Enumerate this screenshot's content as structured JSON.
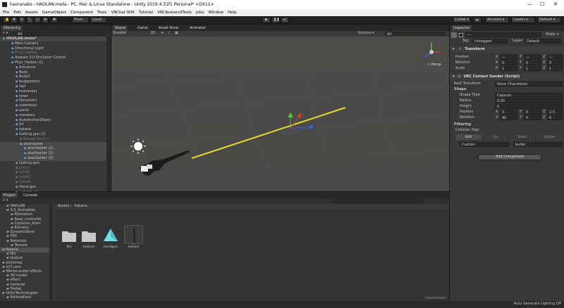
{
  "window": {
    "title": "haoranabs - HAOLAN.meta - PC, Mac & Linux Standalone - Unity 2019.4.31f1 Personal* <DX11>",
    "controls": [
      "—",
      "☐",
      "✕"
    ]
  },
  "menu": [
    "File",
    "Edit",
    "Assets",
    "GameObject",
    "Component",
    "Tools",
    "VRChat SDK",
    "Tutorial",
    "VRCAvatars3Tools",
    "Jobs",
    "Window",
    "Help"
  ],
  "toolbar": {
    "pivot": "Pivot",
    "local": "Local",
    "collab": "Collab ▾",
    "account": "Account ▾",
    "layers": "Layers ▾",
    "layout": "Default ▾"
  },
  "hierarchy": {
    "tab": "Hierarchy",
    "create": "+ ▾",
    "search": "All",
    "rows": [
      {
        "text": "HAOLAN.meta*",
        "indent": 0,
        "style": "scene"
      },
      {
        "text": "Main Camera",
        "indent": 2,
        "style": "normal"
      },
      {
        "text": "Directional Light",
        "indent": 2,
        "style": "normal"
      },
      {
        "text": "Phys_Haolan",
        "indent": 2,
        "style": "dim"
      },
      {
        "text": "Avatars 3.0 Emulator Control",
        "indent": 2,
        "style": "normal"
      },
      {
        "text": "Phys_Haolan (1)",
        "indent": 2,
        "style": "normal"
      },
      {
        "text": "Armature",
        "indent": 3,
        "style": "normal"
      },
      {
        "text": "Body",
        "indent": 3,
        "style": "normal"
      },
      {
        "text": "Body2",
        "indent": 3,
        "style": "normal"
      },
      {
        "text": "buggypants",
        "indent": 3,
        "style": "normal"
      },
      {
        "text": "hair",
        "indent": 3,
        "style": "normal"
      },
      {
        "text": "humanear",
        "indent": 3,
        "style": "normal"
      },
      {
        "text": "Inner",
        "indent": 3,
        "style": "normal"
      },
      {
        "text": "Kemonimi",
        "indent": 3,
        "style": "normal"
      },
      {
        "text": "outerwear",
        "indent": 3,
        "style": "normal"
      },
      {
        "text": "pants",
        "indent": 3,
        "style": "normal"
      },
      {
        "text": "sneakers",
        "indent": 3,
        "style": "normal"
      },
      {
        "text": "AutoAnchorObject",
        "indent": 3,
        "style": "normal"
      },
      {
        "text": "Kil",
        "indent": 3,
        "style": "normal"
      },
      {
        "text": "katana",
        "indent": 3,
        "style": "normal"
      },
      {
        "text": "Gatling gun (1)",
        "indent": 3,
        "style": "normal"
      },
      {
        "text": "Reload fire 1 v",
        "indent": 4,
        "style": "dim"
      },
      {
        "text": "atarihanter",
        "indent": 4,
        "style": "sel"
      },
      {
        "text": "atarihanter (1)",
        "indent": 5,
        "style": "sel"
      },
      {
        "text": "atarihanter (2)",
        "indent": 5,
        "style": "sel"
      },
      {
        "text": "atarihanter (3)",
        "indent": 5,
        "style": "sel"
      },
      {
        "text": "Gatling gun",
        "indent": 3,
        "style": "normal"
      },
      {
        "text": "larnet",
        "indent": 3,
        "style": "dim"
      },
      {
        "text": "larne2",
        "indent": 3,
        "style": "dim"
      },
      {
        "text": "larne3",
        "indent": 3,
        "style": "dim"
      },
      {
        "text": "Cobalt",
        "indent": 3,
        "style": "dim"
      },
      {
        "text": "Hand-gun",
        "indent": 3,
        "style": "normal"
      },
      {
        "text": "Cannon (1)",
        "indent": 3,
        "style": "dim"
      }
    ]
  },
  "scene": {
    "tabs": [
      "Scene",
      "Game",
      "Asset Store",
      "Animator"
    ],
    "shading": "Shaded",
    "mode2d": "2D",
    "gizmos": "Gizmos ▾",
    "search": "All",
    "persp": "< Persp"
  },
  "project": {
    "tabs": [
      "Project",
      "Console"
    ],
    "create": "+ ▾",
    "tree": [
      {
        "text": "HAOLAN",
        "indent": 1,
        "style": "normal"
      },
      {
        "text": "3.0_Animation",
        "indent": 1,
        "style": "normal"
      },
      {
        "text": "Animation",
        "indent": 2,
        "style": "normal"
      },
      {
        "text": "Base_controller",
        "indent": 2,
        "style": "normal"
      },
      {
        "text": "Costume_Anim",
        "indent": 2,
        "style": "normal"
      },
      {
        "text": "EXmenu",
        "indent": 2,
        "style": "normal"
      },
      {
        "text": "DynamicBone",
        "indent": 1,
        "style": "normal"
      },
      {
        "text": "FBX",
        "indent": 1,
        "style": "normal"
      },
      {
        "text": "Materials",
        "indent": 1,
        "style": "normal"
      },
      {
        "text": "Texture",
        "indent": 2,
        "style": "normal"
      },
      {
        "text": "Katana",
        "indent": 0,
        "style": "selgray"
      },
      {
        "text": "fbx",
        "indent": 1,
        "style": "normal"
      },
      {
        "text": "texture",
        "indent": 1,
        "style": "normal"
      },
      {
        "text": "kirishima",
        "indent": 0,
        "style": "normal"
      },
      {
        "text": "k17.com",
        "indent": 0,
        "style": "normal"
      },
      {
        "text": "Mecha bullet effects",
        "indent": 0,
        "style": "normal"
      },
      {
        "text": "3D model",
        "indent": 1,
        "style": "normal"
      },
      {
        "text": "effect",
        "indent": 1,
        "style": "normal"
      },
      {
        "text": "material",
        "indent": 1,
        "style": "normal"
      },
      {
        "text": "Prefab",
        "indent": 1,
        "style": "normal"
      },
      {
        "text": "UnityTechnologies",
        "indent": 0,
        "style": "normal"
      },
      {
        "text": "ParticlePack",
        "indent": 1,
        "style": "normal"
      }
    ],
    "breadcrumb": [
      "Assets",
      "Katana"
    ],
    "assets": [
      {
        "name": "fbx",
        "kind": "folder"
      },
      {
        "name": "texture",
        "kind": "folder"
      },
      {
        "name": "Handgun",
        "kind": "prefab"
      },
      {
        "name": "katana",
        "kind": "model"
      }
    ]
  },
  "inspector": {
    "tab": "Inspector",
    "static": "Static ▾",
    "go_name": "---",
    "tag_label": "Tag",
    "tag_value": "Untagged",
    "layer_label": "Layer",
    "layer_value": "Default",
    "transform_title": "Transform",
    "position_label": "Position",
    "rotation_label": "Rotation",
    "scale_label": "Scale",
    "position": [
      "—",
      "—",
      "—"
    ],
    "rotation": [
      "0",
      "0",
      "0"
    ],
    "scale": [
      "1",
      "1",
      "1"
    ],
    "component_title": "VRC Contact Sender (Script)",
    "root_transform_label": "Root Transform",
    "root_transform_value": "None (Transform)",
    "shape_header": "Shape",
    "shape_type_label": "Shape Type",
    "shape_type_value": "Capsule",
    "radius_label": "Radius",
    "radius_value": "0.05",
    "height_label": "Height",
    "height_value": "6",
    "cpos_label": "Position",
    "cpos": [
      "0",
      "0",
      "2.5"
    ],
    "crot_label": "Rotation",
    "crot": [
      "90",
      "0",
      "0"
    ],
    "filtering_header": "Filtering",
    "collision_tags_label": "Collision Tags",
    "tag_buttons": [
      "Add",
      "Up",
      "Down",
      "Delete"
    ],
    "tag_type": "Custom",
    "tag_name": "bullet",
    "add_component": "Add Component"
  },
  "status": {
    "right": "Auto Generate Lighting Off"
  }
}
